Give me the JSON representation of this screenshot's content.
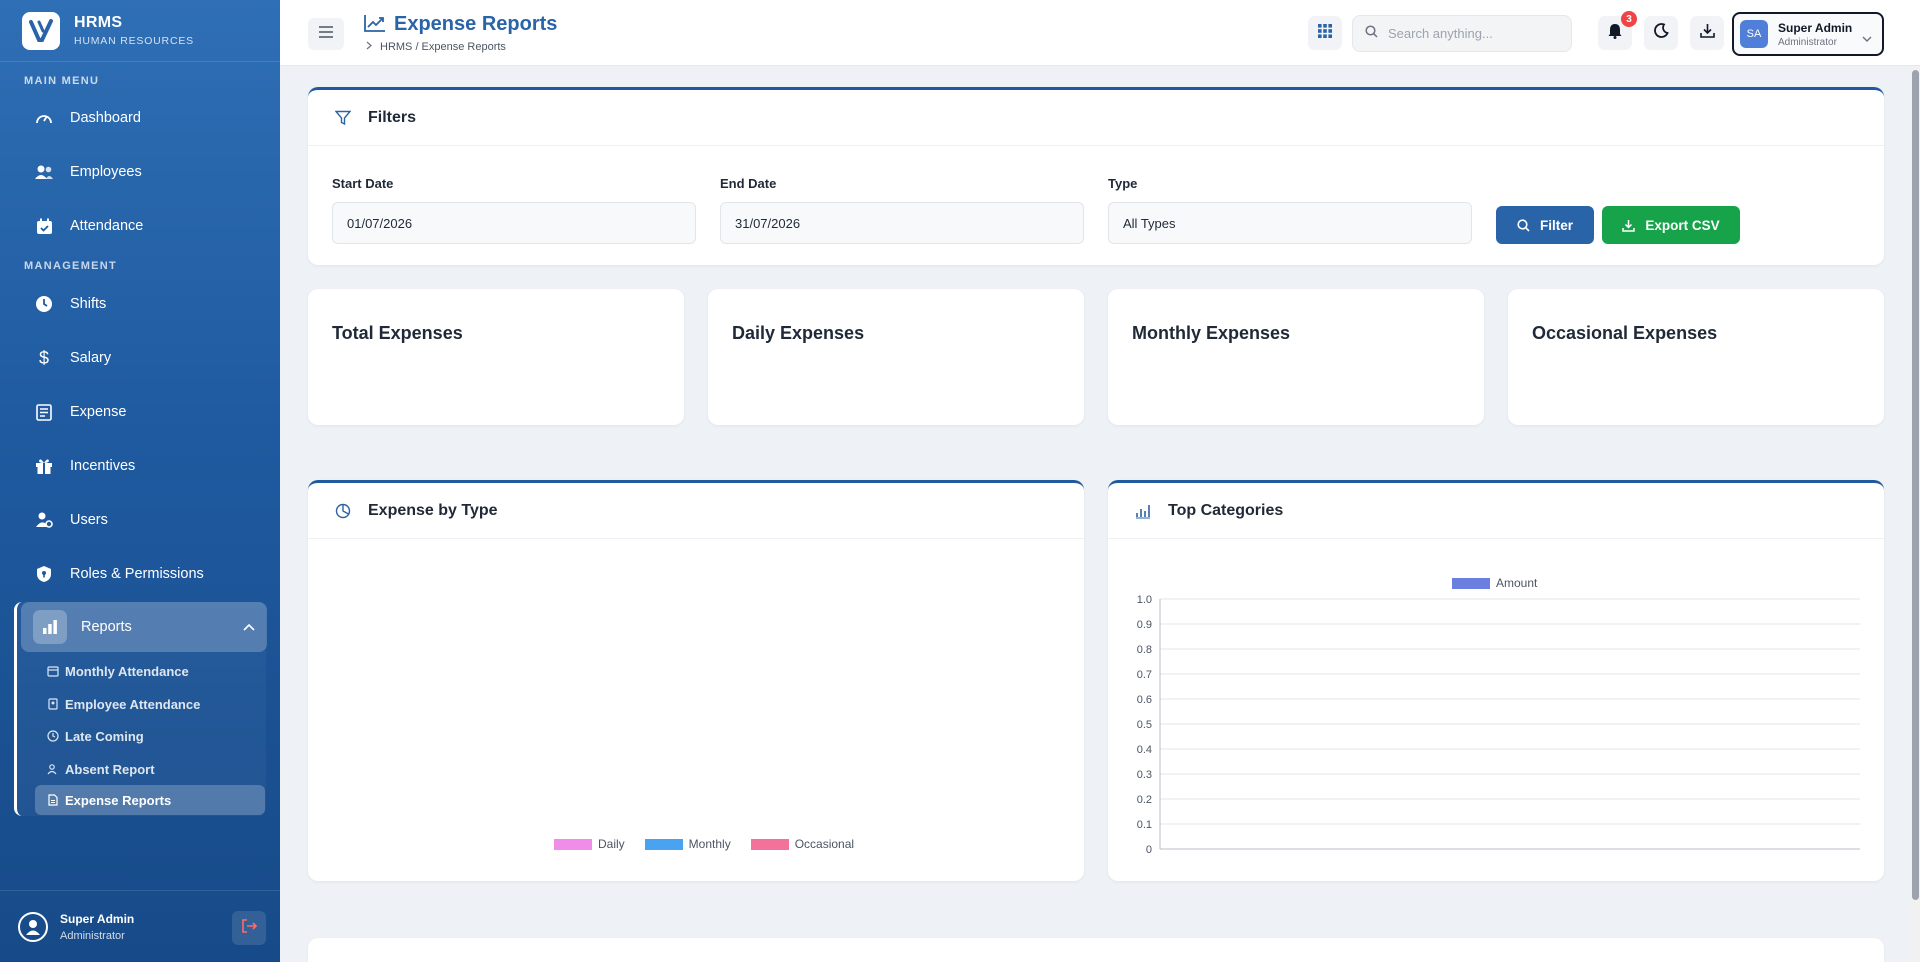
{
  "brand": {
    "title": "HRMS",
    "subtitle": "HUMAN RESOURCES"
  },
  "sidebar": {
    "main_menu_label": "MAIN MENU",
    "management_label": "MANAGEMENT",
    "main_items": [
      {
        "label": "Dashboard",
        "icon": "gauge-icon"
      },
      {
        "label": "Employees",
        "icon": "users-icon"
      },
      {
        "label": "Attendance",
        "icon": "calendar-check-icon"
      }
    ],
    "management_items": [
      {
        "label": "Shifts",
        "icon": "clock-icon"
      },
      {
        "label": "Salary",
        "icon": "dollar-icon"
      },
      {
        "label": "Expense",
        "icon": "receipt-icon"
      },
      {
        "label": "Incentives",
        "icon": "gift-icon"
      },
      {
        "label": "Users",
        "icon": "user-cog-icon"
      },
      {
        "label": "Roles & Permissions",
        "icon": "shield-icon"
      }
    ],
    "reports": {
      "label": "Reports",
      "items": [
        {
          "label": "Monthly Attendance"
        },
        {
          "label": "Employee Attendance"
        },
        {
          "label": "Late Coming"
        },
        {
          "label": "Absent Report"
        },
        {
          "label": "Expense Reports"
        }
      ]
    },
    "footer": {
      "name": "Super Admin",
      "role": "Administrator"
    }
  },
  "header": {
    "title": "Expense Reports",
    "breadcrumb": "HRMS / Expense Reports",
    "search_placeholder": "Search anything...",
    "notification_count": "3",
    "user": {
      "initials": "SA",
      "name": "Super Admin",
      "role": "Administrator"
    }
  },
  "filters": {
    "title": "Filters",
    "start_date_label": "Start Date",
    "start_date": "01/07/2026",
    "end_date_label": "End Date",
    "end_date": "31/07/2026",
    "type_label": "Type",
    "type_value": "All Types",
    "filter_button": "Filter",
    "export_button": "Export CSV"
  },
  "stats": [
    {
      "title": "Total Expenses"
    },
    {
      "title": "Daily Expenses"
    },
    {
      "title": "Monthly Expenses"
    },
    {
      "title": "Occasional Expenses"
    }
  ],
  "expense_by_type": {
    "title": "Expense by Type",
    "legend": [
      {
        "label": "Daily",
        "color": "#f08de6"
      },
      {
        "label": "Monthly",
        "color": "#4aa3f0"
      },
      {
        "label": "Occasional",
        "color": "#f2729a"
      }
    ]
  },
  "top_categories": {
    "title": "Top Categories",
    "legend_label": "Amount",
    "legend_color": "#6b7fe0"
  },
  "chart_data": {
    "type": "bar",
    "categories": [],
    "series": [
      {
        "name": "Amount",
        "values": []
      }
    ],
    "title": "Top Categories",
    "ylim": [
      0,
      1.0
    ],
    "yticks": [
      "1.0",
      "0.9",
      "0.8",
      "0.7",
      "0.6",
      "0.5",
      "0.4",
      "0.3",
      "0.2",
      "0.1",
      "0"
    ],
    "grid": true,
    "legend_position": "top"
  },
  "colors": {
    "accent": "#1f5aa0",
    "filter_button": "#2a64a8",
    "export_button": "#16a34a"
  }
}
